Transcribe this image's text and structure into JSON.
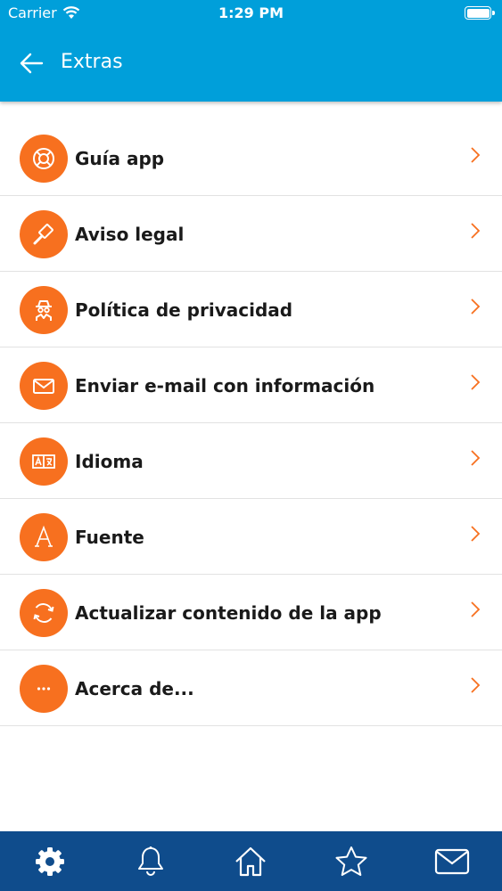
{
  "status_bar": {
    "carrier": "Carrier",
    "time": "1:29 PM"
  },
  "header": {
    "title": "Extras",
    "background_color": "#009fda"
  },
  "menu": {
    "accent_color": "#f7701f",
    "items": [
      {
        "label": "Guía app",
        "icon": "lifebuoy-icon"
      },
      {
        "label": "Aviso legal",
        "icon": "gavel-icon"
      },
      {
        "label": "Política de privacidad",
        "icon": "spy-icon"
      },
      {
        "label": "Enviar e-mail con información",
        "icon": "envelope-icon"
      },
      {
        "label": "Idioma",
        "icon": "translate-icon"
      },
      {
        "label": "Fuente",
        "icon": "font-icon"
      },
      {
        "label": "Actualizar contenido de la app",
        "icon": "refresh-icon"
      },
      {
        "label": "Acerca de...",
        "icon": "ellipsis-icon"
      }
    ]
  },
  "tab_bar": {
    "background_color": "#0f4c8c",
    "tabs": [
      {
        "icon": "gear-icon",
        "active": true
      },
      {
        "icon": "bell-icon",
        "active": false
      },
      {
        "icon": "home-icon",
        "active": false
      },
      {
        "icon": "star-icon",
        "active": false
      },
      {
        "icon": "mail-icon",
        "active": false
      }
    ]
  }
}
